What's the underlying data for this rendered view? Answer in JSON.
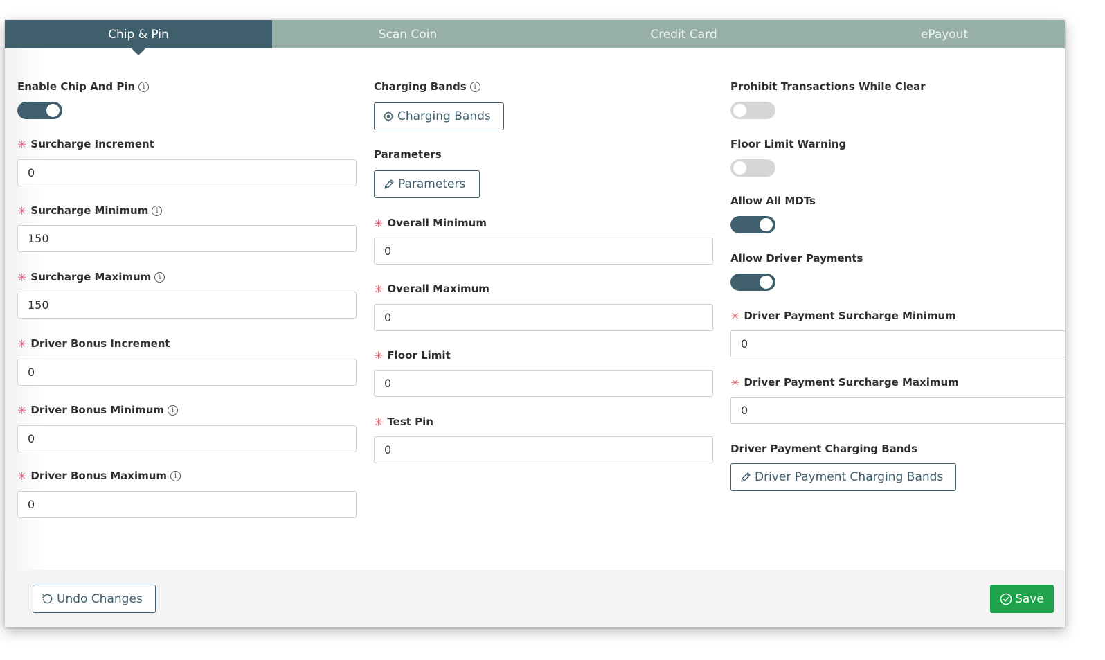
{
  "tabs": [
    {
      "label": "Chip & Pin",
      "active": true
    },
    {
      "label": "Scan Coin",
      "active": false
    },
    {
      "label": "Credit Card",
      "active": false
    },
    {
      "label": "ePayout",
      "active": false
    }
  ],
  "col1": {
    "enable_chip_pin": {
      "label": "Enable Chip And Pin",
      "on": true
    },
    "surcharge_increment": {
      "label": "Surcharge Increment",
      "value": "0"
    },
    "surcharge_minimum": {
      "label": "Surcharge Minimum",
      "value": "150"
    },
    "surcharge_maximum": {
      "label": "Surcharge Maximum",
      "value": "150"
    },
    "driver_bonus_increment": {
      "label": "Driver Bonus Increment",
      "value": "0"
    },
    "driver_bonus_minimum": {
      "label": "Driver Bonus Minimum",
      "value": "0"
    },
    "driver_bonus_maximum": {
      "label": "Driver Bonus Maximum",
      "value": "0"
    }
  },
  "col2": {
    "charging_bands": {
      "label": "Charging Bands",
      "button": "Charging Bands"
    },
    "parameters": {
      "label": "Parameters",
      "button": "Parameters"
    },
    "overall_minimum": {
      "label": "Overall Minimum",
      "value": "0"
    },
    "overall_maximum": {
      "label": "Overall Maximum",
      "value": "0"
    },
    "floor_limit": {
      "label": "Floor Limit",
      "value": "0"
    },
    "test_pin": {
      "label": "Test Pin",
      "value": "0"
    }
  },
  "col3": {
    "prohibit_transactions": {
      "label": "Prohibit Transactions While Clear",
      "on": false
    },
    "floor_limit_warning": {
      "label": "Floor Limit Warning",
      "on": false
    },
    "allow_all_mdts": {
      "label": "Allow All MDTs",
      "on": true
    },
    "allow_driver_payments": {
      "label": "Allow Driver Payments",
      "on": true
    },
    "driver_payment_surcharge_minimum": {
      "label": "Driver Payment Surcharge Minimum",
      "value": "0"
    },
    "driver_payment_surcharge_maximum": {
      "label": "Driver Payment Surcharge Maximum",
      "value": "0"
    },
    "driver_payment_charging_bands": {
      "label": "Driver Payment Charging Bands",
      "button": "Driver Payment Charging Bands"
    }
  },
  "footer": {
    "undo_label": "Undo Changes",
    "save_label": "Save"
  },
  "icons": {
    "info": "info-circle-icon",
    "required": "asterisk-icon",
    "target": "target-icon",
    "pencil": "pencil-icon",
    "undo": "undo-icon",
    "check": "check-circle-icon"
  },
  "colors": {
    "primary": "#3f5f6d",
    "tab_inactive": "#98b1a7",
    "required": "#e05a6b",
    "save": "#1ea34a",
    "toggle_off": "#d6d6d6"
  }
}
